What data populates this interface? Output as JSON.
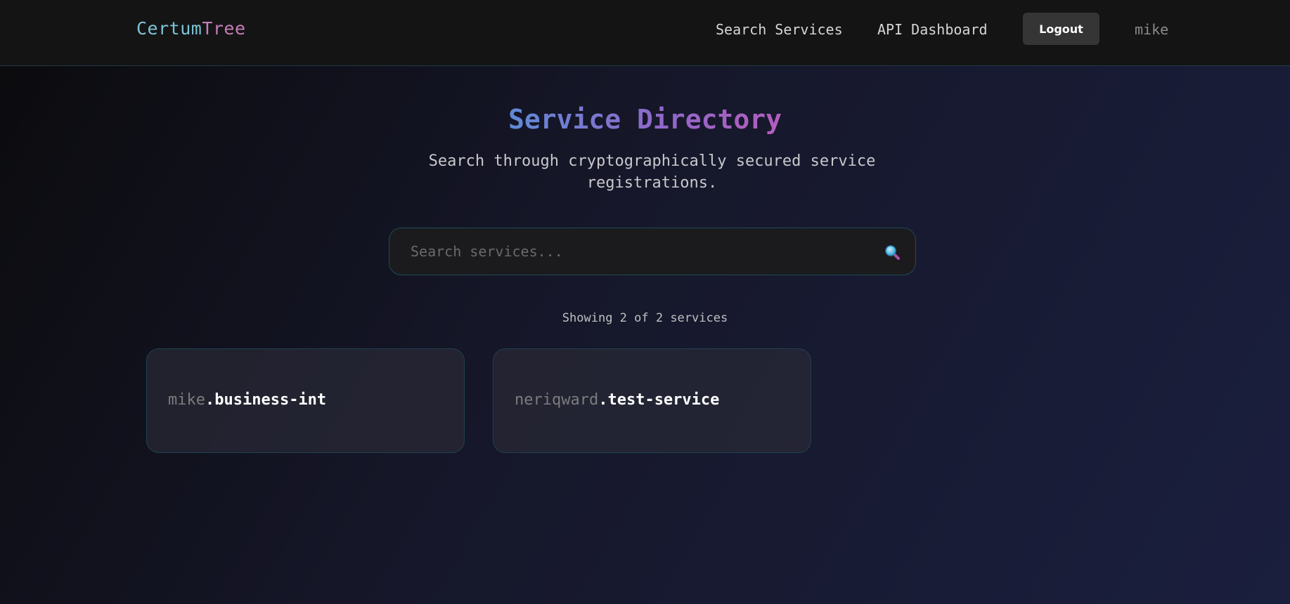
{
  "colors": {
    "brand_primary": "#7cc4d8",
    "brand_secondary": "#c77dba",
    "title_gradient_start": "#5f8ad6",
    "title_gradient_end": "#b45dbe",
    "accent_border": "#1f4a55"
  },
  "header": {
    "brand_part1": "Certum",
    "brand_part2": "Tree",
    "nav_search": "Search Services",
    "nav_api": "API Dashboard",
    "logout_label": "Logout",
    "username": "mike"
  },
  "main": {
    "title": "Service Directory",
    "subtitle": "Search through cryptographically secured service registrations.",
    "search_placeholder": "Search services...",
    "search_icon": "magnifier-icon",
    "result_count": "Showing 2 of 2 services",
    "services": [
      {
        "owner": "mike",
        "name": ".business-int"
      },
      {
        "owner": "neriqward",
        "name": ".test-service"
      }
    ]
  }
}
